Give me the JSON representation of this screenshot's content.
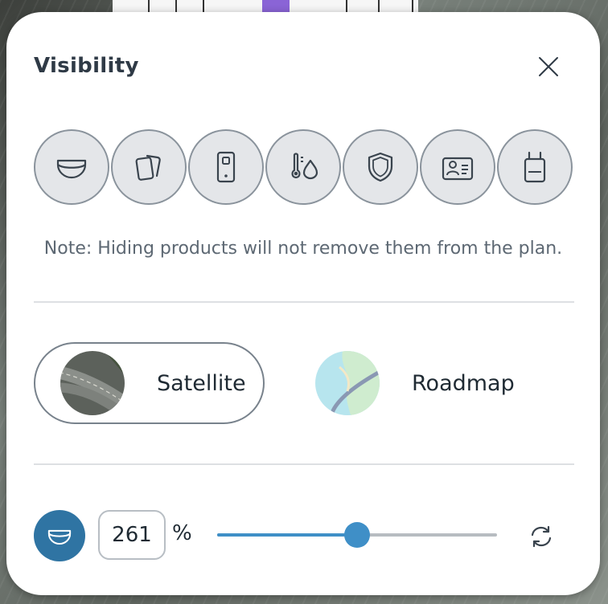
{
  "panel": {
    "title": "Visibility",
    "close_icon": "close-icon"
  },
  "product_categories": [
    {
      "name": "dome-camera",
      "icon": "dome-camera-icon"
    },
    {
      "name": "access-card",
      "icon": "access-card-icon"
    },
    {
      "name": "intercom",
      "icon": "intercom-icon"
    },
    {
      "name": "environmental-sensor",
      "icon": "temperature-humidity-icon"
    },
    {
      "name": "alarm",
      "icon": "shield-icon"
    },
    {
      "name": "badge",
      "icon": "id-badge-icon"
    },
    {
      "name": "gateway",
      "icon": "gateway-icon"
    }
  ],
  "note": "Note: Hiding products will not remove them from the plan.",
  "map_types": {
    "selected": "Satellite",
    "options": [
      {
        "label": "Satellite",
        "icon": "satellite-thumbnail"
      },
      {
        "label": "Roadmap",
        "icon": "roadmap-thumbnail"
      }
    ]
  },
  "plan_opacity": {
    "value": "261",
    "unit": "%",
    "slider_fraction": 0.5,
    "accent": "#3f8fc7",
    "button_color": "#2f74a3"
  },
  "colors": {
    "title": "#2f3a46",
    "icon_bg": "#e4e6e9",
    "icon_border": "#8a939c"
  }
}
